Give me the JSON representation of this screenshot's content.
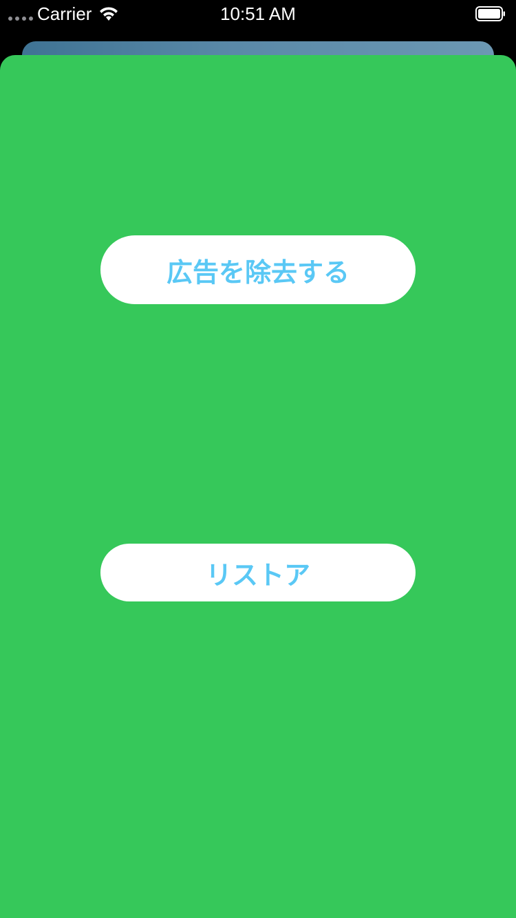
{
  "status_bar": {
    "carrier": "Carrier",
    "time": "10:51 AM",
    "signal_icon": "signal-dots-icon",
    "wifi_icon": "wifi-icon",
    "battery_icon": "battery-icon"
  },
  "colors": {
    "sheet_background": "#36c85a",
    "button_background": "#ffffff",
    "button_text": "#5ac8f5",
    "status_bar_background": "#000000"
  },
  "actions": {
    "remove_ads_label": "広告を除去する",
    "restore_label": "リストア"
  }
}
